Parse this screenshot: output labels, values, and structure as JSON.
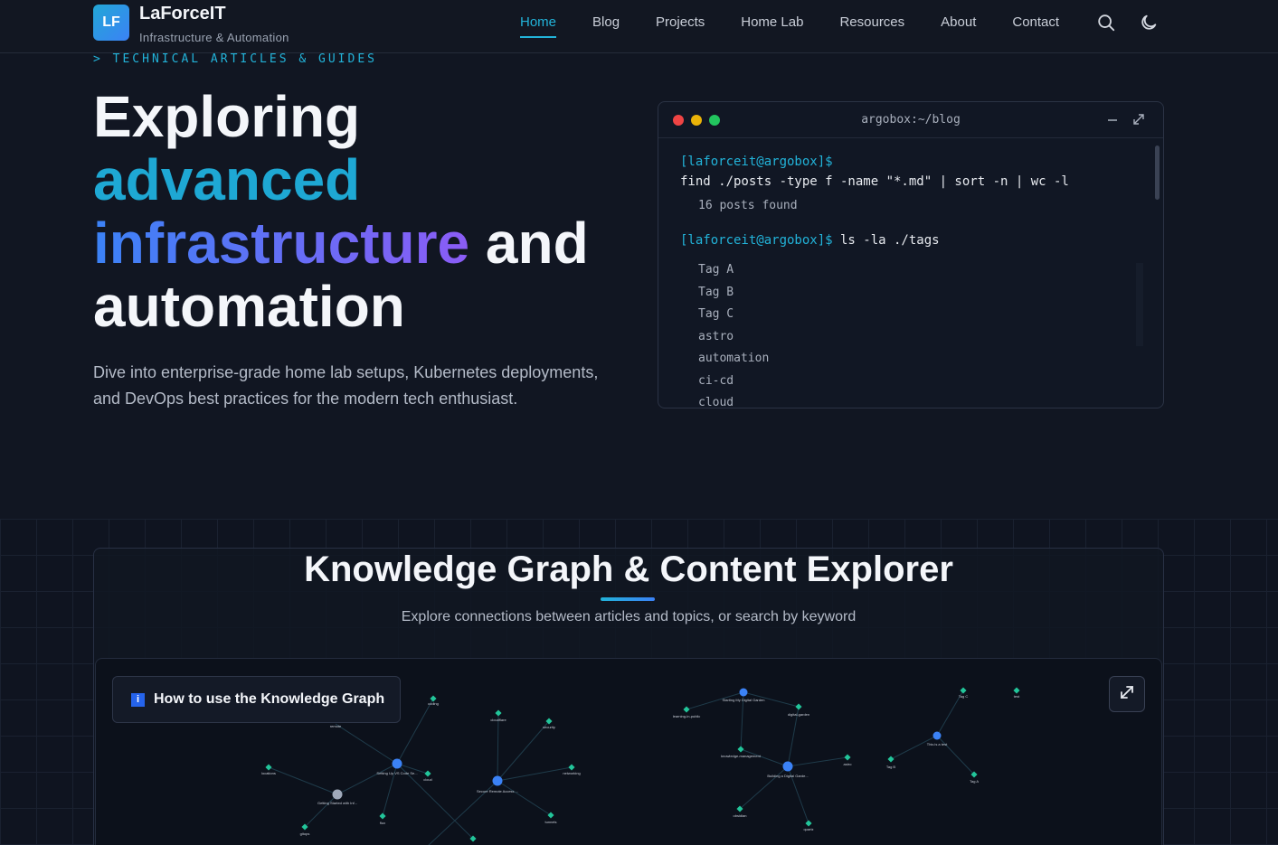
{
  "brand": {
    "logo_text": "LF",
    "name": "LaForceIT",
    "tagline": "Infrastructure & Automation"
  },
  "nav": {
    "items": [
      {
        "label": "Home",
        "active": true
      },
      {
        "label": "Blog",
        "active": false
      },
      {
        "label": "Projects",
        "active": false
      },
      {
        "label": "Home Lab",
        "active": false
      },
      {
        "label": "Resources",
        "active": false
      },
      {
        "label": "About",
        "active": false
      },
      {
        "label": "Contact",
        "active": false
      }
    ],
    "search_icon": "search-icon",
    "theme_icon": "moon-icon"
  },
  "hero": {
    "eyebrow": "> TECHNICAL ARTICLES & GUIDES",
    "title_line1": "Exploring",
    "title_line2": "advanced",
    "title_line3a": "infrastructure",
    "title_line3b": " and",
    "title_line4": "automation",
    "description": "Dive into enterprise-grade home lab setups, Kubernetes deployments, and DevOps best practices for the modern tech enthusiast."
  },
  "terminal": {
    "title": "argobox:~/blog",
    "prompt": "[laforceit@argobox]$",
    "command1": "find ./posts -type f -name \"*.md\" | sort -n | wc -l",
    "output1": "16 posts found",
    "command2": " ls -la ./tags",
    "tags": [
      "Tag A",
      "Tag B",
      "Tag C",
      "astro",
      "automation",
      "ci-cd",
      "cloud"
    ],
    "colors": {
      "red": "#ef4444",
      "yellow": "#eab308",
      "green": "#22c55e"
    }
  },
  "knowledge": {
    "title": "Knowledge Graph & Content Explorer",
    "subtitle": "Explore connections between articles and topics, or search by keyword",
    "help_label": "How to use the Knowledge Graph",
    "info_icon": "i",
    "expand_icon": "expand-icon",
    "nodes": [
      {
        "label": "remote"
      },
      {
        "label": "coding"
      },
      {
        "label": "cloudflare"
      },
      {
        "label": "security"
      },
      {
        "label": "Setting Up VS Code Se..."
      },
      {
        "label": "cloud"
      },
      {
        "label": "networking"
      },
      {
        "label": "locations"
      },
      {
        "label": "Getting Started with Inf..."
      },
      {
        "label": "Secure Remote Access ..."
      },
      {
        "label": "flux"
      },
      {
        "label": "tunnels"
      },
      {
        "label": "gitops"
      },
      {
        "label": "Starting My Digital Garden"
      },
      {
        "label": "learning-in-public"
      },
      {
        "label": "digital-garden"
      },
      {
        "label": "knowledge-management"
      },
      {
        "label": "Building a Digital Garde..."
      },
      {
        "label": "astro"
      },
      {
        "label": "obsidian"
      },
      {
        "label": "quartz"
      },
      {
        "label": "Tag C"
      },
      {
        "label": "test"
      },
      {
        "label": "This is a test"
      },
      {
        "label": "Tag B"
      },
      {
        "label": "Tag A"
      }
    ]
  }
}
